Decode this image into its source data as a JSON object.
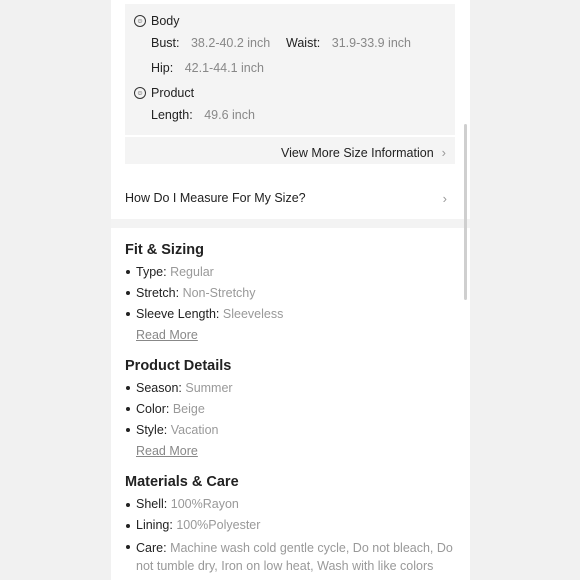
{
  "size_info": {
    "body": {
      "title": "Body",
      "icon": "body-measure-icon",
      "bust_label": "Bust:",
      "bust_value": "38.2-40.2 inch",
      "waist_label": "Waist:",
      "waist_value": "31.9-33.9 inch",
      "hip_label": "Hip:",
      "hip_value": "42.1-44.1 inch"
    },
    "product": {
      "title": "Product",
      "icon": "product-measure-icon",
      "length_label": "Length:",
      "length_value": "49.6 inch"
    },
    "view_more_label": "View More Size Information"
  },
  "measure_link": "How Do I Measure For My Size?",
  "fit_sizing": {
    "title": "Fit & Sizing",
    "items": [
      {
        "key": "Type:",
        "value": "Regular"
      },
      {
        "key": "Stretch:",
        "value": "Non-Stretchy"
      },
      {
        "key": "Sleeve Length:",
        "value": "Sleeveless"
      }
    ],
    "read_more": "Read More"
  },
  "product_details": {
    "title": "Product Details",
    "items": [
      {
        "key": "Season:",
        "value": "Summer"
      },
      {
        "key": "Color:",
        "value": "Beige"
      },
      {
        "key": "Style:",
        "value": "Vacation"
      }
    ],
    "read_more": "Read More"
  },
  "materials_care": {
    "title": "Materials & Care",
    "items": [
      {
        "key": "Shell:",
        "value": "100%Rayon"
      },
      {
        "key": "Lining:",
        "value": "100%Polyester"
      },
      {
        "key": "Care:",
        "value": "Machine wash cold gentle cycle, Do not bleach, Do not tumble dry, Iron on low heat, Wash with like colors"
      }
    ]
  },
  "colors": {
    "accent_text": "#222222",
    "muted_text": "#999999",
    "box_bg": "#f4f4f4"
  }
}
